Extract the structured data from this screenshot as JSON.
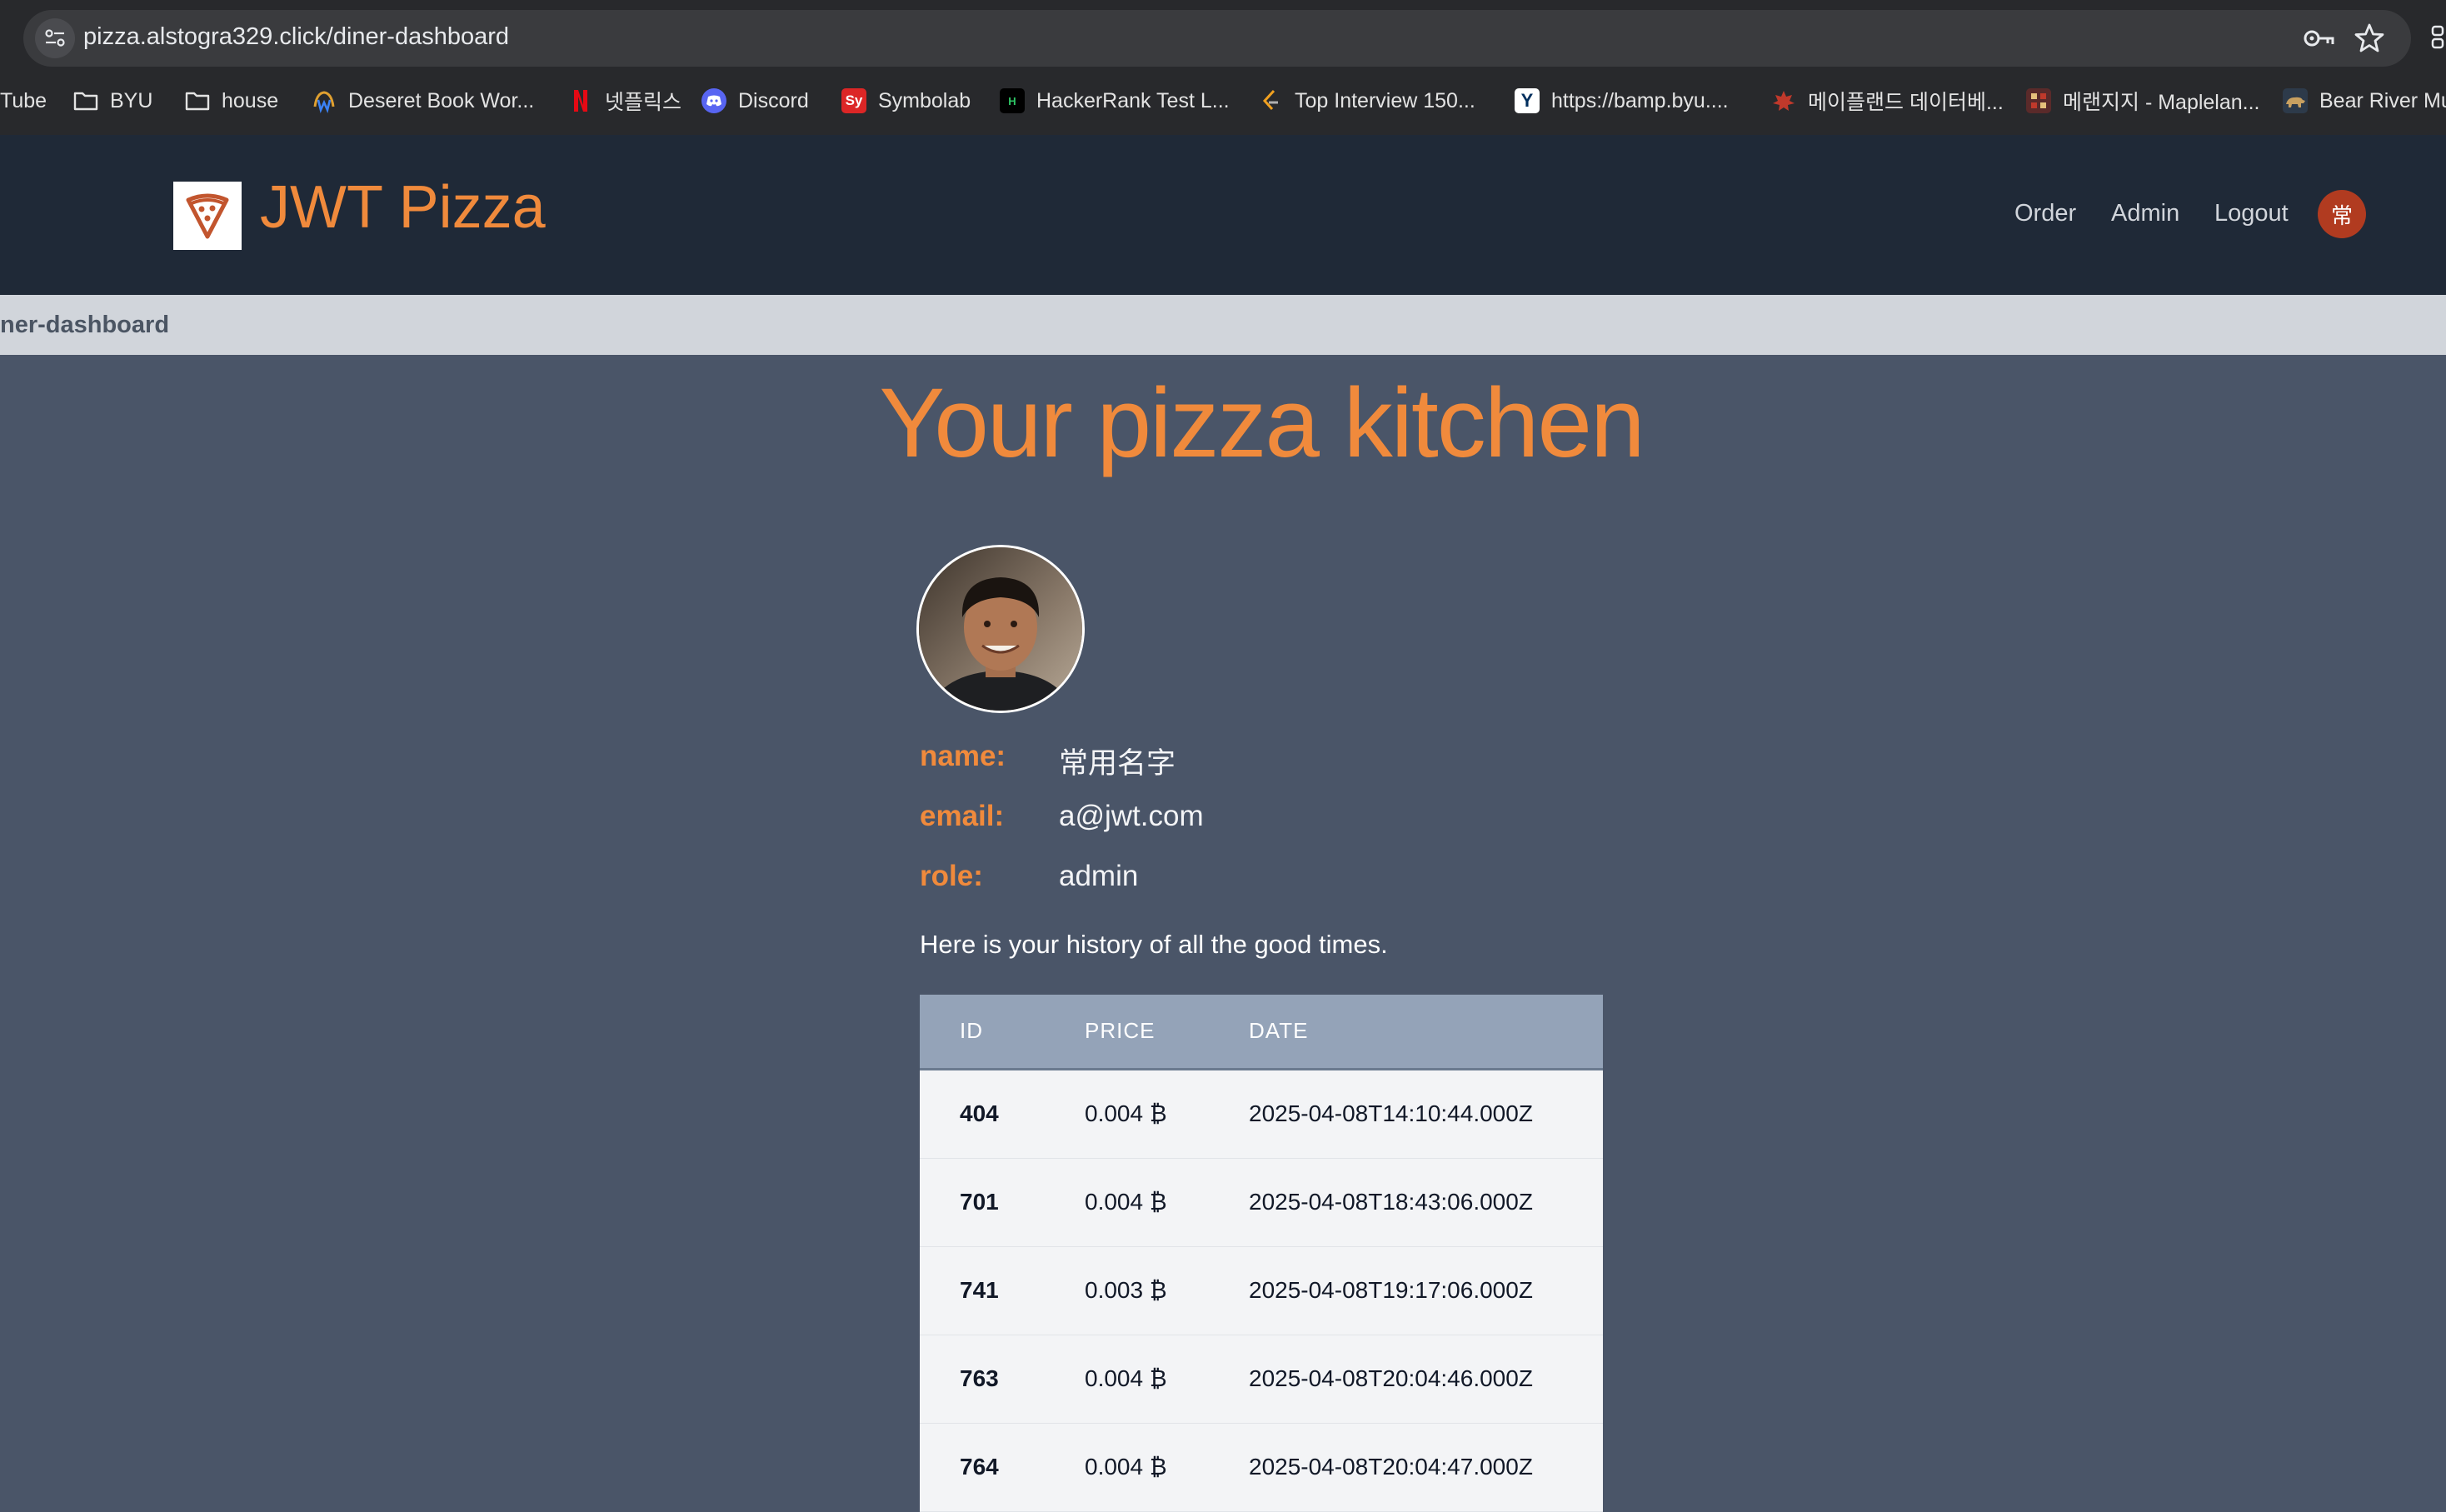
{
  "browser": {
    "url": "pizza.alstogra329.click/diner-dashboard",
    "bookmarks": [
      {
        "label": "Tube",
        "icon": "youtube-icon"
      },
      {
        "label": "BYU",
        "icon": "folder-icon"
      },
      {
        "label": "house",
        "icon": "folder-icon"
      },
      {
        "label": "Deseret Book Wor...",
        "icon": "deseret-book-icon"
      },
      {
        "label": "넷플릭스",
        "icon": "netflix-icon"
      },
      {
        "label": "Discord",
        "icon": "discord-icon"
      },
      {
        "label": "Symbolab",
        "icon": "symbolab-icon"
      },
      {
        "label": "HackerRank Test L...",
        "icon": "hackerrank-icon"
      },
      {
        "label": "Top Interview 150...",
        "icon": "leetcode-icon"
      },
      {
        "label": "https://bamp.byu....",
        "icon": "byu-y-icon"
      },
      {
        "label": "메이플랜드 데이터베...",
        "icon": "maple-leaf-icon"
      },
      {
        "label": "메랜지지 - Maplelan...",
        "icon": "maplelan-icon"
      },
      {
        "label": "Bear River Mu",
        "icon": "bear-icon"
      }
    ]
  },
  "header": {
    "brand": "JWT Pizza",
    "nav": [
      "Order",
      "Admin",
      "Logout"
    ],
    "user_initial": "常"
  },
  "breadcrumb": "ner-dashboard",
  "main": {
    "title": "Your pizza kitchen",
    "profile": {
      "name_label": "name:",
      "name_value": "常用名字",
      "email_label": "email:",
      "email_value": "a@jwt.com",
      "role_label": "role:",
      "role_value": "admin"
    },
    "history_text": "Here is your history of all the good times.",
    "table": {
      "headers": [
        "ID",
        "PRICE",
        "DATE"
      ],
      "rows": [
        {
          "id": "404",
          "price": "0.004 ₿",
          "date": "2025-04-08T14:10:44.000Z"
        },
        {
          "id": "701",
          "price": "0.004 ₿",
          "date": "2025-04-08T18:43:06.000Z"
        },
        {
          "id": "741",
          "price": "0.003 ₿",
          "date": "2025-04-08T19:17:06.000Z"
        },
        {
          "id": "763",
          "price": "0.004 ₿",
          "date": "2025-04-08T20:04:46.000Z"
        },
        {
          "id": "764",
          "price": "0.004 ₿",
          "date": "2025-04-08T20:04:47.000Z"
        }
      ]
    }
  },
  "colors": {
    "accent": "#f08a3c",
    "page_bg": "#4a5568",
    "header_bg": "#1f2937",
    "badge": "#b13b20"
  }
}
